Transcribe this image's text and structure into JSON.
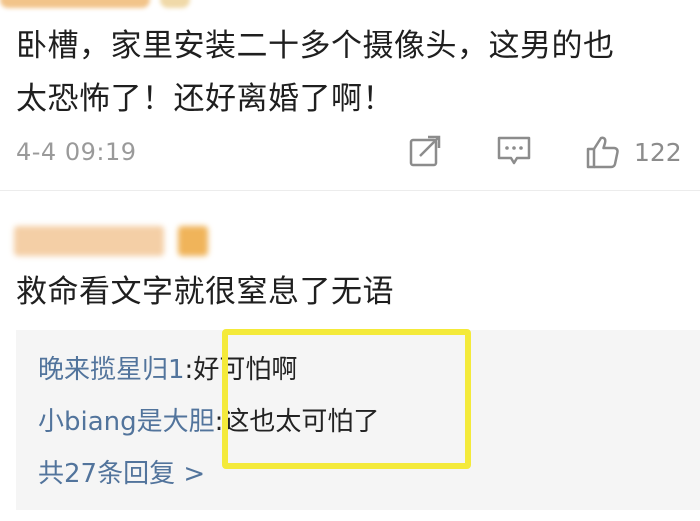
{
  "post": {
    "text_line1": "卧槽，家里安装二十多个摄像头，这男的也",
    "text_line2": "太恐怖了！还好离婚了啊！",
    "timestamp": "4-4 09:19",
    "like_count": "122"
  },
  "comment": {
    "text": "救命看文字就很窒息了无语"
  },
  "replies": {
    "items": [
      {
        "user": "晚来揽星归1",
        "sep": ":",
        "text": "好可怕啊"
      },
      {
        "user": "小biang是大胆",
        "sep": ":",
        "text": "这也太可怕了"
      }
    ],
    "more_label": "共27条回复 >"
  },
  "icons": {
    "share": "share-icon",
    "comment": "comment-icon",
    "like": "thumbs-up-icon"
  },
  "colors": {
    "link_blue": "#52749c",
    "meta_gray": "#9a9a9a",
    "reply_bg": "#f5f5f5",
    "highlight_yellow": "#f4ea3a"
  }
}
